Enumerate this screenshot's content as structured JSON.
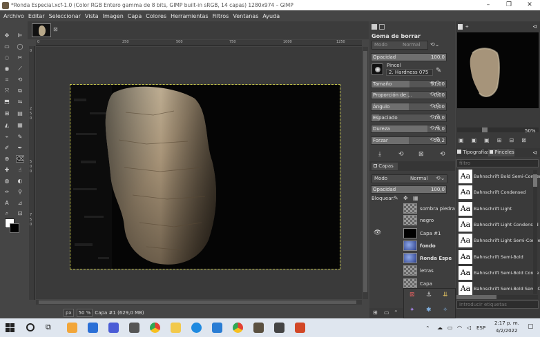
{
  "window": {
    "title": "*Ronda Especial.xcf-1.0 (Color RGB Entero gamma de 8 bits, GIMP built-in sRGB, 14 capas) 1280x974 – GIMP",
    "minimize": "–",
    "maximize": "❐",
    "close": "✕"
  },
  "menu": [
    "Archivo",
    "Editar",
    "Seleccionar",
    "Vista",
    "Imagen",
    "Capa",
    "Colores",
    "Herramientas",
    "Filtros",
    "Ventanas",
    "Ayuda"
  ],
  "image_tab": {
    "close": "⊠"
  },
  "ruler": {
    "top_labels": [
      "0",
      "250",
      "500",
      "750",
      "1000",
      "1250"
    ],
    "left_labels": [
      "0",
      "2",
      "5",
      "0",
      "5",
      "0",
      "0",
      "7",
      "5",
      "0"
    ]
  },
  "statusbar": {
    "unit": "px",
    "zoom": "50 %",
    "layer_info": "Capa #1 (629,0 MB)"
  },
  "tool_options": {
    "title": "Goma de borrar",
    "mode_label": "Modo",
    "mode_value": "Normal",
    "opacity_label": "Opacidad",
    "opacity_value": "100,0",
    "opacity_fraction": 1.0,
    "brush_label": "Pincel",
    "brush_value": "2. Hardness 075",
    "rows": [
      {
        "label": "Tamaño",
        "value": "51,00",
        "fraction": 0.51
      },
      {
        "label": "Proporción de ...",
        "value": "0,00",
        "fraction": 0.5
      },
      {
        "label": "Ángulo",
        "value": "0,00",
        "fraction": 0.5
      },
      {
        "label": "Espaciado",
        "value": "10,0",
        "fraction": 0.1
      },
      {
        "label": "Dureza",
        "value": "75,0",
        "fraction": 0.75
      },
      {
        "label": "Forzar",
        "value": "50,2",
        "fraction": 0.5
      }
    ]
  },
  "layers": {
    "tab": "Capas",
    "mode_label": "Modo",
    "mode_value": "Normal",
    "opacity_label": "Opacidad",
    "opacity_value": "100,0",
    "lock_label": "Bloquear:",
    "items": [
      {
        "name": "sombra piedra",
        "thumb": "checker",
        "bold": false,
        "visible": false
      },
      {
        "name": "negro",
        "thumb": "checker",
        "bold": false,
        "visible": false
      },
      {
        "name": "Capa #1",
        "thumb": "black",
        "bold": false,
        "visible": true
      },
      {
        "name": "fondo",
        "thumb": "blue",
        "bold": true,
        "visible": false
      },
      {
        "name": "Ronda Espe",
        "thumb": "blue",
        "bold": true,
        "visible": false
      },
      {
        "name": "letras",
        "thumb": "checker",
        "bold": false,
        "visible": false
      },
      {
        "name": "Capa",
        "thumb": "checker",
        "bold": false,
        "visible": false
      }
    ]
  },
  "navigator": {
    "zoom": "50%"
  },
  "fonts_panel": {
    "tab_fonts": "Tipografías",
    "tab_brushes": "Pinceles",
    "filter_placeholder": "filtro",
    "tags_placeholder": "Introducir etiquetas",
    "items": [
      "Bahnschrift Bold Semi-Conden",
      "Bahnschrift Condensed",
      "Bahnschrift Light",
      "Bahnschrift Light Condensed",
      "Bahnschrift Light Semi-Conde",
      "Bahnschrift Semi-Bold",
      "Bahnschrift Semi-Bold Conde",
      "Bahnschrift Semi-Bold Semi-C"
    ],
    "sample": "Aa"
  },
  "taskbar": {
    "time": "2:17 p. m.",
    "date": "4/2/2022",
    "lang": "ESP"
  },
  "colors": {
    "accent": "#4a6fd6",
    "selection": "#c8c84a"
  }
}
